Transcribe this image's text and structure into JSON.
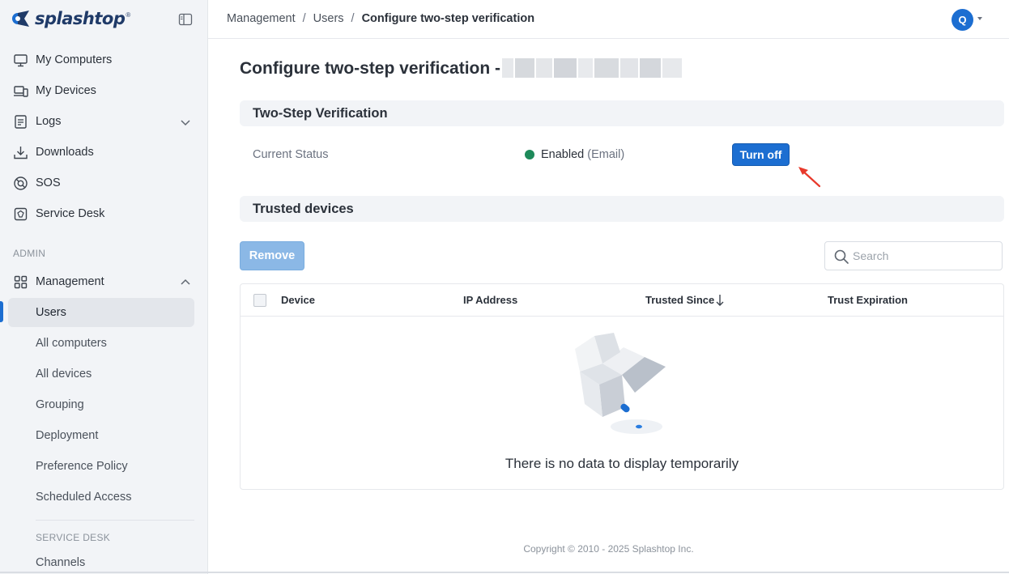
{
  "brand": {
    "name": "splashtop",
    "mark": "®",
    "color": "#1f3a68"
  },
  "sidebar": {
    "items": [
      {
        "label": "My Computers",
        "icon": "monitor-icon"
      },
      {
        "label": "My Devices",
        "icon": "devices-icon"
      },
      {
        "label": "Logs",
        "icon": "log-icon"
      },
      {
        "label": "Downloads",
        "icon": "download-icon"
      },
      {
        "label": "SOS",
        "icon": "sos-icon"
      },
      {
        "label": "Service Desk",
        "icon": "service-desk-icon"
      }
    ],
    "admin_label": "ADMIN",
    "management": {
      "label": "Management",
      "icon": "grid-icon",
      "expanded": true,
      "sub_items": [
        {
          "label": "Users",
          "active": true
        },
        {
          "label": "All computers"
        },
        {
          "label": "All devices"
        },
        {
          "label": "Grouping"
        },
        {
          "label": "Deployment"
        },
        {
          "label": "Preference Policy"
        },
        {
          "label": "Scheduled Access"
        }
      ]
    },
    "service_desk_label": "SERVICE DESK",
    "service_desk_items": [
      {
        "label": "Channels"
      }
    ]
  },
  "header": {
    "breadcrumb": [
      "Management",
      "Users",
      "Configure two-step verification"
    ],
    "avatar_initial": "Q"
  },
  "main": {
    "title": "Configure two-step verification -",
    "two_step": {
      "section_title": "Two-Step Verification",
      "status_label": "Current Status",
      "status_value": "Enabled",
      "status_method": "(Email)",
      "status_color": "#1e8a5a",
      "turn_off_label": "Turn off"
    },
    "trusted": {
      "section_title": "Trusted devices",
      "remove_label": "Remove",
      "search_placeholder": "Search",
      "columns": [
        "Device",
        "IP Address",
        "Trusted Since",
        "Trust Expiration"
      ],
      "sort_column": "Trusted Since",
      "sort_direction": "descending",
      "rows": [],
      "empty_text": "There is no data to display temporarily"
    }
  },
  "footer": {
    "copyright": "Copyright © 2010 - 2025 Splashtop Inc."
  },
  "colors": {
    "accent": "#1c6ed1",
    "sidebar_bg": "#f2f4f7",
    "annotation_arrow": "#e8392b"
  }
}
